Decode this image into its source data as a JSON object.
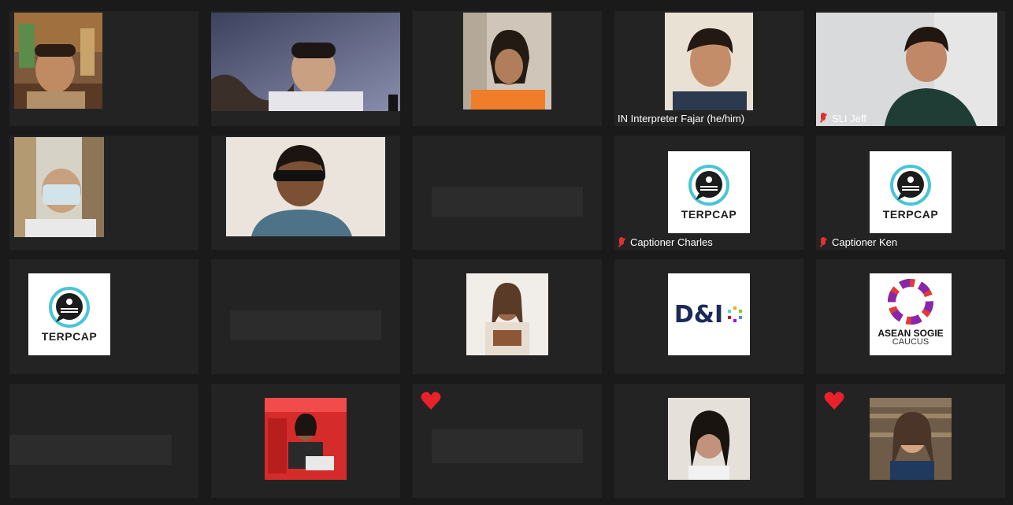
{
  "participants": [
    {
      "name": "",
      "muted": false,
      "content": "video"
    },
    {
      "name": "",
      "muted": false,
      "content": "video"
    },
    {
      "name": "",
      "muted": false,
      "content": "video"
    },
    {
      "name": "IN Interpreter Fajar (he/him)",
      "muted": false,
      "content": "video"
    },
    {
      "name": "SLI Jeff",
      "muted": true,
      "content": "video"
    },
    {
      "name": "",
      "muted": false,
      "content": "video"
    },
    {
      "name": "",
      "muted": false,
      "content": "video"
    },
    {
      "name": "",
      "muted": false,
      "content": "video-off"
    },
    {
      "name": "Captioner Charles",
      "muted": true,
      "content": "logo",
      "logo_text": "TERPCAP"
    },
    {
      "name": "Captioner Ken",
      "muted": true,
      "content": "logo",
      "logo_text": "TERPCAP"
    },
    {
      "name": "",
      "muted": false,
      "content": "logo",
      "logo_text": "TERPCAP"
    },
    {
      "name": "",
      "muted": false,
      "content": "video-off"
    },
    {
      "name": "",
      "muted": false,
      "content": "video"
    },
    {
      "name": "",
      "muted": false,
      "content": "logo",
      "logo_text": "D&I"
    },
    {
      "name": "",
      "muted": false,
      "content": "logo",
      "logo_text": "ASEAN SOGIE",
      "logo_subtext": "CAUCUS"
    },
    {
      "name": "",
      "muted": false,
      "content": "video-off"
    },
    {
      "name": "",
      "muted": false,
      "content": "video"
    },
    {
      "name": "",
      "muted": false,
      "content": "video-off",
      "reaction": "heart-icon"
    },
    {
      "name": "",
      "muted": false,
      "content": "video"
    },
    {
      "name": "",
      "muted": false,
      "content": "video",
      "reaction": "heart-icon"
    }
  ],
  "colors": {
    "background": "#1a1a1a",
    "tile": "#232323",
    "muted_icon": "#e0312f",
    "reaction_heart": "#e8212b",
    "terpcap_ring": "#49c5d6",
    "name_text": "#ffffff"
  }
}
